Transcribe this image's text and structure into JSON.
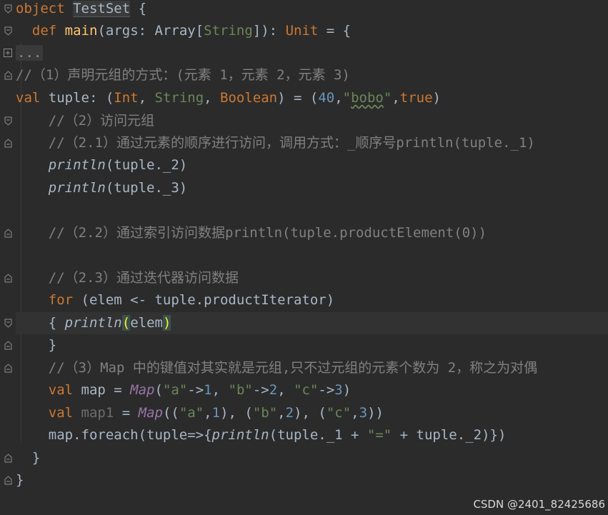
{
  "code": {
    "l1": {
      "kw": "object",
      "name": "TestSet",
      "rest": " {"
    },
    "l2": {
      "indent": "  ",
      "kw": "def",
      "fn": "main",
      "p1": "(args: Array[",
      "type": "String",
      "p2": "]): ",
      "ret": "Unit",
      "p3": " = {"
    },
    "l3": {
      "folded": "..."
    },
    "l4": {
      "comment": "//（1）声明元组的方式：(元素 1，元素 2，元素 3)"
    },
    "l5": {
      "kw": "val",
      "t1": " tuple: (",
      "ty1": "Int",
      "c1": ", ",
      "ty2": "String",
      "c2": ", ",
      "ty3": "Boolean",
      "t2": ") = (",
      "num": "40",
      "c3": ",",
      "str_open": "\"",
      "str_word": "bobo",
      "str_close": "\"",
      "c4": ",",
      "bool": "true",
      "t3": ")"
    },
    "l6": {
      "indent": "    ",
      "comment": "//（2）访问元组"
    },
    "l7": {
      "indent": "    ",
      "comment": "//（2.1）通过元素的顺序进行访问，调用方式：_顺序号println(tuple._1)"
    },
    "l8": {
      "indent": "    ",
      "fn": "println",
      "rest": "(tuple._2)"
    },
    "l9": {
      "indent": "    ",
      "fn": "println",
      "rest": "(tuple._3)"
    },
    "l11": {
      "indent": "    ",
      "comment": "//（2.2）通过索引访问数据println(tuple.productElement(0))"
    },
    "l13": {
      "indent": "    ",
      "comment": "//（2.3）通过迭代器访问数据"
    },
    "l14": {
      "indent": "    ",
      "kw": "for",
      "rest": " (elem <- tuple.productIterator)"
    },
    "l15": {
      "indent": "    ",
      "open": "{ ",
      "fn": "println",
      "paren_open": "(",
      "arg": "elem",
      "paren_close": ")"
    },
    "l16": {
      "indent": "    ",
      "close": "}"
    },
    "l17": {
      "indent": "    ",
      "comment": "//（3）Map 中的键值对其实就是元组,只不过元组的元素个数为 2，称之为对偶"
    },
    "l18": {
      "indent": "    ",
      "kw": "val",
      "t1": " map = ",
      "fn": "Map",
      "t2": "(",
      "s1": "\"a\"",
      "a1": "->",
      "n1": "1",
      "c1": ", ",
      "s2": "\"b\"",
      "a2": "->",
      "n2": "2",
      "c2": ", ",
      "s3": "\"c\"",
      "a3": "->",
      "n3": "3",
      "t3": ")"
    },
    "l19": {
      "indent": "    ",
      "kw": "val",
      "name": " map1",
      "t1": " = ",
      "fn": "Map",
      "t2": "((",
      "s1": "\"a\"",
      "c1": ",",
      "n1": "1",
      "t3": "), (",
      "s2": "\"b\"",
      "c2": ",",
      "n2": "2",
      "t4": "), (",
      "s3": "\"c\"",
      "c3": ",",
      "n3": "3",
      "t5": "))"
    },
    "l20": {
      "indent": "    ",
      "t1": "map.foreach(tuple=>{",
      "fn": "println",
      "t2": "(tuple._1 + ",
      "str": "\"=\"",
      "t3": " + tuple._2)})"
    },
    "l21": {
      "indent": "  ",
      "close": "}"
    },
    "l22": {
      "close": "}"
    }
  },
  "watermark": "CSDN @2401_82425686",
  "colors": {
    "background": "#2b2b2b",
    "keyword": "#cc7832",
    "string": "#6a8759",
    "number": "#6897bb",
    "comment": "#808080",
    "function": "#ffc66d",
    "text": "#a9b7c6",
    "purple": "#9876aa"
  },
  "icons": [
    "fold-icon",
    "unfold-icon"
  ]
}
